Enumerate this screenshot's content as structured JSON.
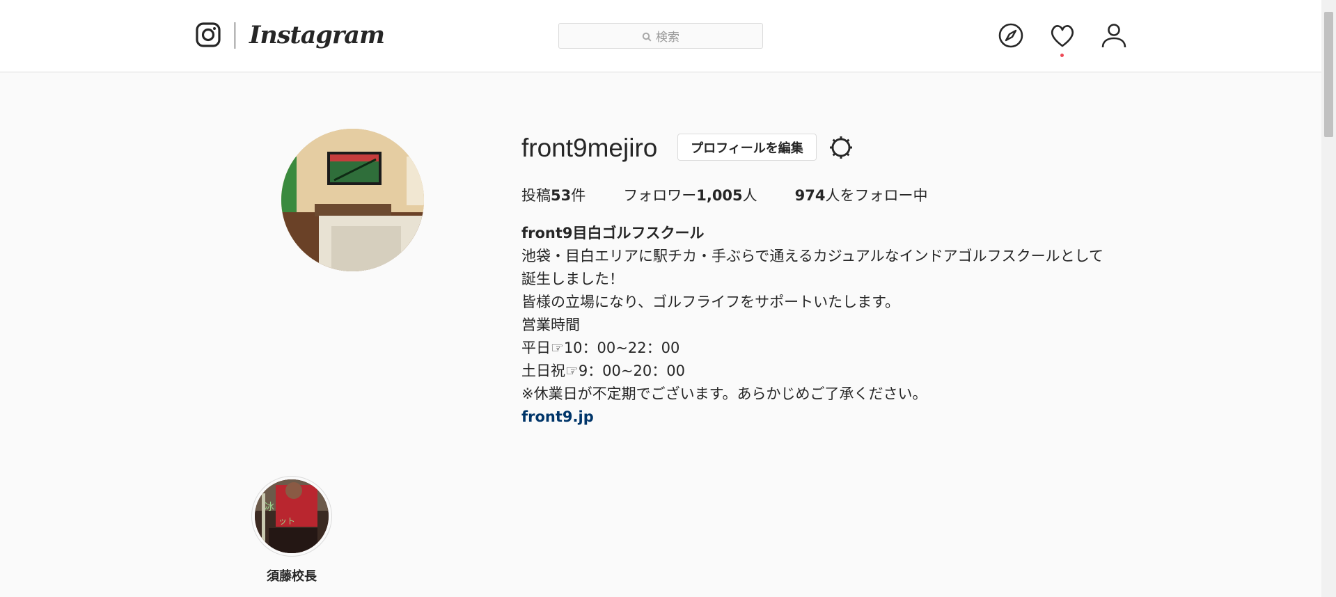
{
  "header": {
    "wordmark": "Instagram",
    "search_placeholder": "検索",
    "icons": [
      "instagram-glyph-icon",
      "compass-icon",
      "heart-icon",
      "user-icon"
    ],
    "notification_color": "#ed4956"
  },
  "profile": {
    "username": "front9mejiro",
    "edit_button": "プロフィールを編集",
    "settings_icon": "gear-icon",
    "stats": {
      "posts_prefix": "投稿",
      "posts_count": "53",
      "posts_suffix": "件",
      "followers_prefix": "フォロワー",
      "followers_count": "1,005",
      "followers_suffix": "人",
      "following_count": "974",
      "following_suffix": "人をフォロー中"
    },
    "bio": {
      "name": "front9目白ゴルフスクール",
      "lines": [
        "池袋・目白エリアに駅チカ・手ぶらで通えるカジュアルなインドアゴルフスクールとして誕生しました！",
        "皆様の立場になり、ゴルフライフをサポートいたします。",
        "営業時間",
        "平日☞10：00~22：00",
        "土日祝☞9：00~20：00",
        "※休業日が不定期でございます。あらかじめご了承ください。"
      ],
      "link": "front9.jp",
      "link_color": "#003569"
    }
  },
  "highlights": [
    {
      "label": "須藤校長"
    }
  ]
}
